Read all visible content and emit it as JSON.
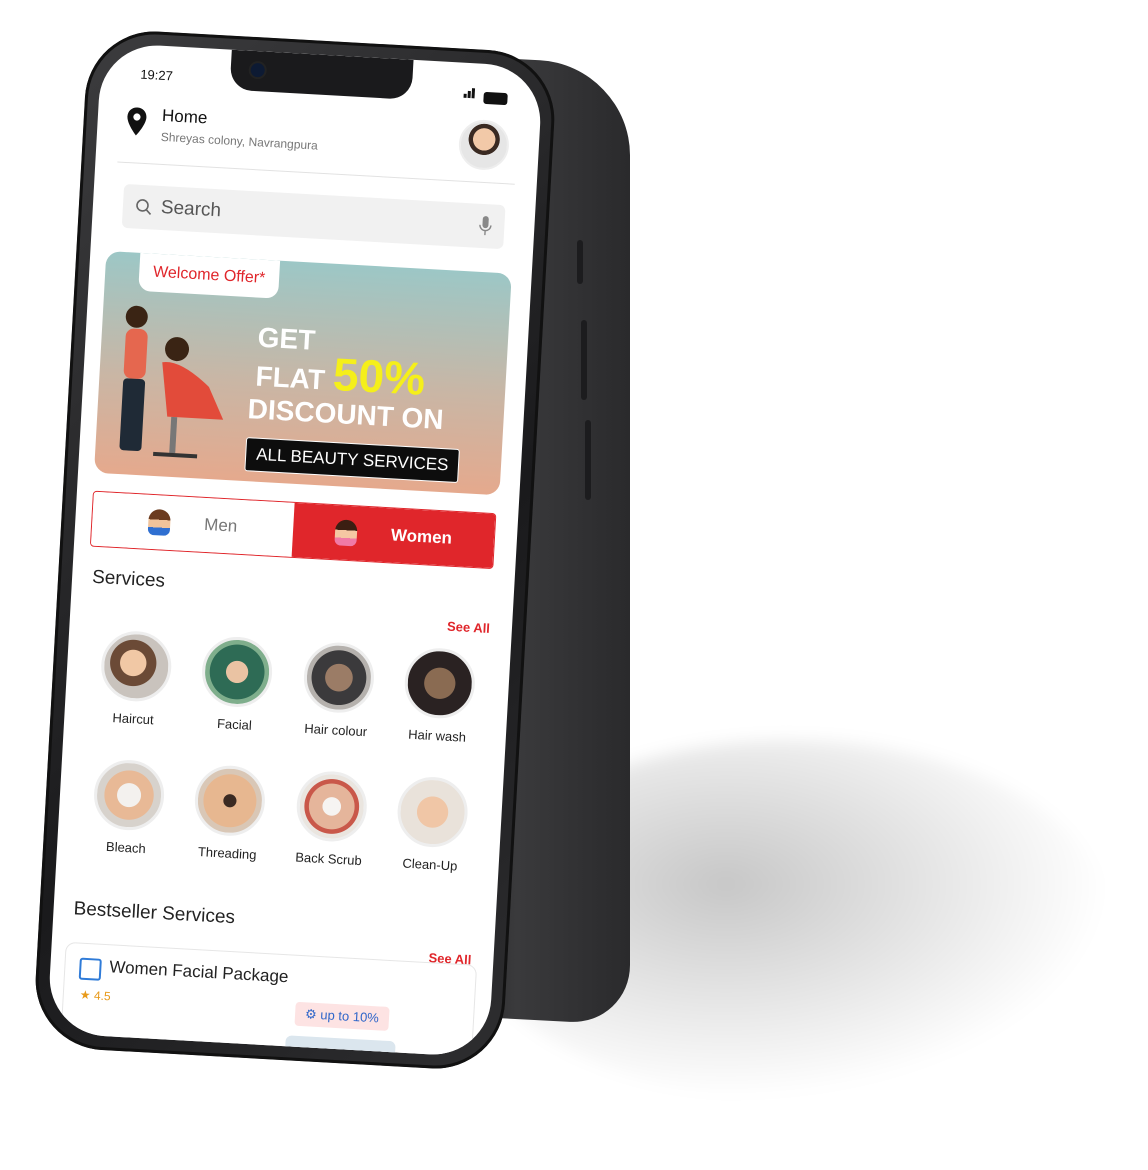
{
  "status": {
    "time": "19:27"
  },
  "location": {
    "title": "Home",
    "subtitle": "Shreyas colony, Navrangpura"
  },
  "search": {
    "placeholder": "Search"
  },
  "banner": {
    "tag": "Welcome Offer*",
    "line1": "GET",
    "line2a": "FLAT",
    "line2b": "50%",
    "line3": "DISCOUNT ON",
    "line4": "ALL BEAUTY SERVICES"
  },
  "gender": {
    "men": "Men",
    "women": "Women"
  },
  "services": {
    "title": "Services",
    "see_all": "See All",
    "items": [
      {
        "label": "Haircut"
      },
      {
        "label": "Facial"
      },
      {
        "label": "Hair colour"
      },
      {
        "label": "Hair wash"
      },
      {
        "label": "Bleach"
      },
      {
        "label": "Threading"
      },
      {
        "label": "Back Scrub"
      },
      {
        "label": "Clean-Up"
      }
    ]
  },
  "bestseller": {
    "title": "Bestseller Services",
    "see_all": "See All",
    "card": {
      "title": "Women Facial Package",
      "rating": "4.5",
      "badge": "up to 10%"
    }
  },
  "colors": {
    "accent": "#e0262b",
    "highlight": "#f5ef1a",
    "badge_text": "#2f66c9"
  }
}
